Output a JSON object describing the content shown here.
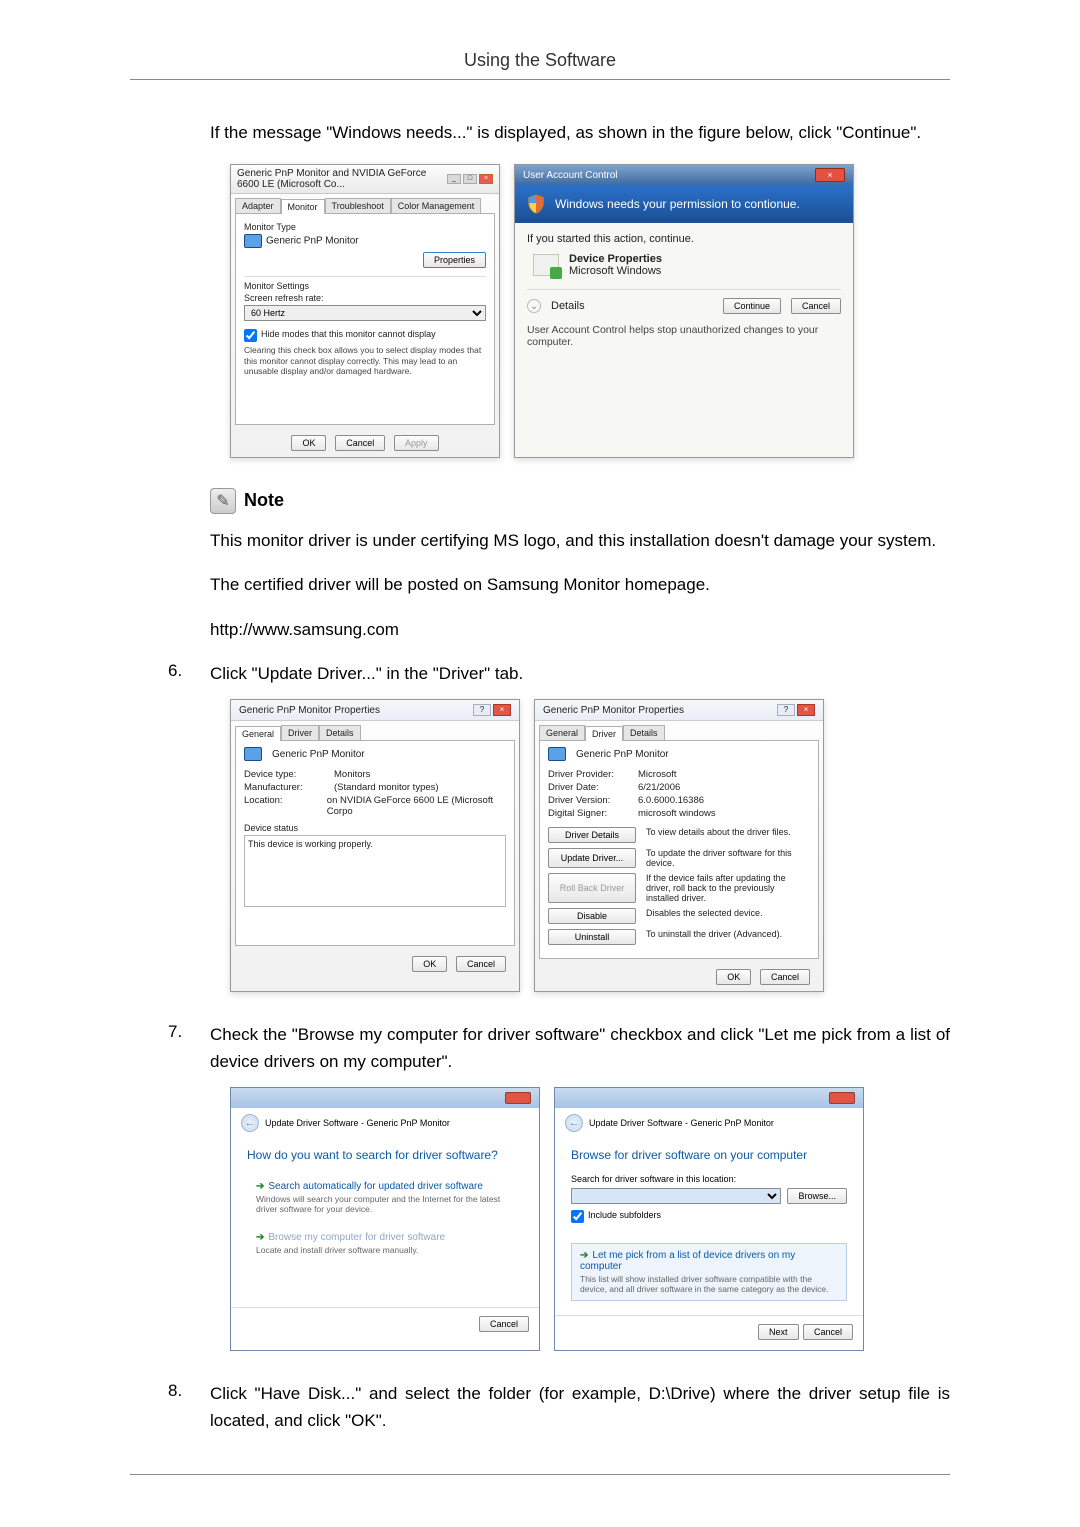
{
  "header": {
    "title": "Using the Software"
  },
  "intro": {
    "text": "If the message \"Windows needs...\" is displayed, as shown in the figure below, click \"Continue\"."
  },
  "dlg_monitor": {
    "title": "Generic PnP Monitor and NVIDIA GeForce 6600 LE (Microsoft Co...",
    "tabs": {
      "adapter": "Adapter",
      "monitor": "Monitor",
      "troubleshoot": "Troubleshoot",
      "color": "Color Management"
    },
    "monitor_type_label": "Monitor Type",
    "monitor_type_value": "Generic PnP Monitor",
    "properties_btn": "Properties",
    "settings_label": "Monitor Settings",
    "refresh_label": "Screen refresh rate:",
    "refresh_value": "60 Hertz",
    "hide_modes": "Hide modes that this monitor cannot display",
    "hide_modes_desc": "Clearing this check box allows you to select display modes that this monitor cannot display correctly. This may lead to an unusable display and/or damaged hardware.",
    "ok": "OK",
    "cancel": "Cancel",
    "apply": "Apply"
  },
  "uac": {
    "titlebar": "User Account Control",
    "band": "Windows needs your permission to contionue.",
    "if_started": "If you started this action, continue.",
    "prog_name": "Device Properties",
    "prog_pub": "Microsoft Windows",
    "details": "Details",
    "continue": "Continue",
    "cancel": "Cancel",
    "footer": "User Account Control helps stop unauthorized changes to your computer."
  },
  "note": {
    "label": "Note",
    "p1": "This monitor driver is under certifying MS logo, and this installation doesn't damage your system.",
    "p2": "The certified driver will be posted on Samsung Monitor homepage.",
    "p3": "http://www.samsung.com"
  },
  "step6": {
    "num": "6.",
    "text": "Click \"Update Driver...\" in the \"Driver\" tab."
  },
  "prop_general": {
    "title": "Generic PnP Monitor Properties",
    "tabs": {
      "general": "General",
      "driver": "Driver",
      "details": "Details"
    },
    "device_name": "Generic PnP Monitor",
    "kv": {
      "device_type_k": "Device type:",
      "device_type_v": "Monitors",
      "manufacturer_k": "Manufacturer:",
      "manufacturer_v": "(Standard monitor types)",
      "location_k": "Location:",
      "location_v": "on NVIDIA GeForce 6600 LE (Microsoft Corpo"
    },
    "status_label": "Device status",
    "status_text": "This device is working properly.",
    "ok": "OK",
    "cancel": "Cancel"
  },
  "prop_driver": {
    "title": "Generic PnP Monitor Properties",
    "device_name": "Generic PnP Monitor",
    "kv": {
      "provider_k": "Driver Provider:",
      "provider_v": "Microsoft",
      "date_k": "Driver Date:",
      "date_v": "6/21/2006",
      "version_k": "Driver Version:",
      "version_v": "6.0.6000.16386",
      "signer_k": "Digital Signer:",
      "signer_v": "microsoft windows"
    },
    "btns": {
      "details": "Driver Details",
      "details_d": "To view details about the driver files.",
      "update": "Update Driver...",
      "update_d": "To update the driver software for this device.",
      "rollback": "Roll Back Driver",
      "rollback_d": "If the device fails after updating the driver, roll back to the previously installed driver.",
      "disable": "Disable",
      "disable_d": "Disables the selected device.",
      "uninstall": "Uninstall",
      "uninstall_d": "To uninstall the driver (Advanced)."
    },
    "ok": "OK",
    "cancel": "Cancel"
  },
  "step7": {
    "num": "7.",
    "text": "Check the \"Browse my computer for driver software\" checkbox and click \"Let me pick from a list of device drivers on my computer\"."
  },
  "wiz1": {
    "crumb": "Update Driver Software - Generic PnP Monitor",
    "heading": "How do you want to search for driver software?",
    "opt1_t": "Search automatically for updated driver software",
    "opt1_d": "Windows will search your computer and the Internet for the latest driver software for your device.",
    "opt2_t": "Browse my computer for driver software",
    "opt2_d": "Locate and install driver software manually.",
    "cancel": "Cancel"
  },
  "wiz2": {
    "crumb": "Update Driver Software - Generic PnP Monitor",
    "heading": "Browse for driver software on your computer",
    "search_label": "Search for driver software in this location:",
    "path_value": "",
    "browse": "Browse...",
    "include": "Include subfolders",
    "opt_t": "Let me pick from a list of device drivers on my computer",
    "opt_d": "This list will show installed driver software compatible with the device, and all driver software in the same category as the device.",
    "next": "Next",
    "cancel": "Cancel"
  },
  "step8": {
    "num": "8.",
    "text": "Click \"Have Disk...\" and select the folder (for example, D:\\Drive) where the driver setup file is located, and click \"OK\"."
  }
}
